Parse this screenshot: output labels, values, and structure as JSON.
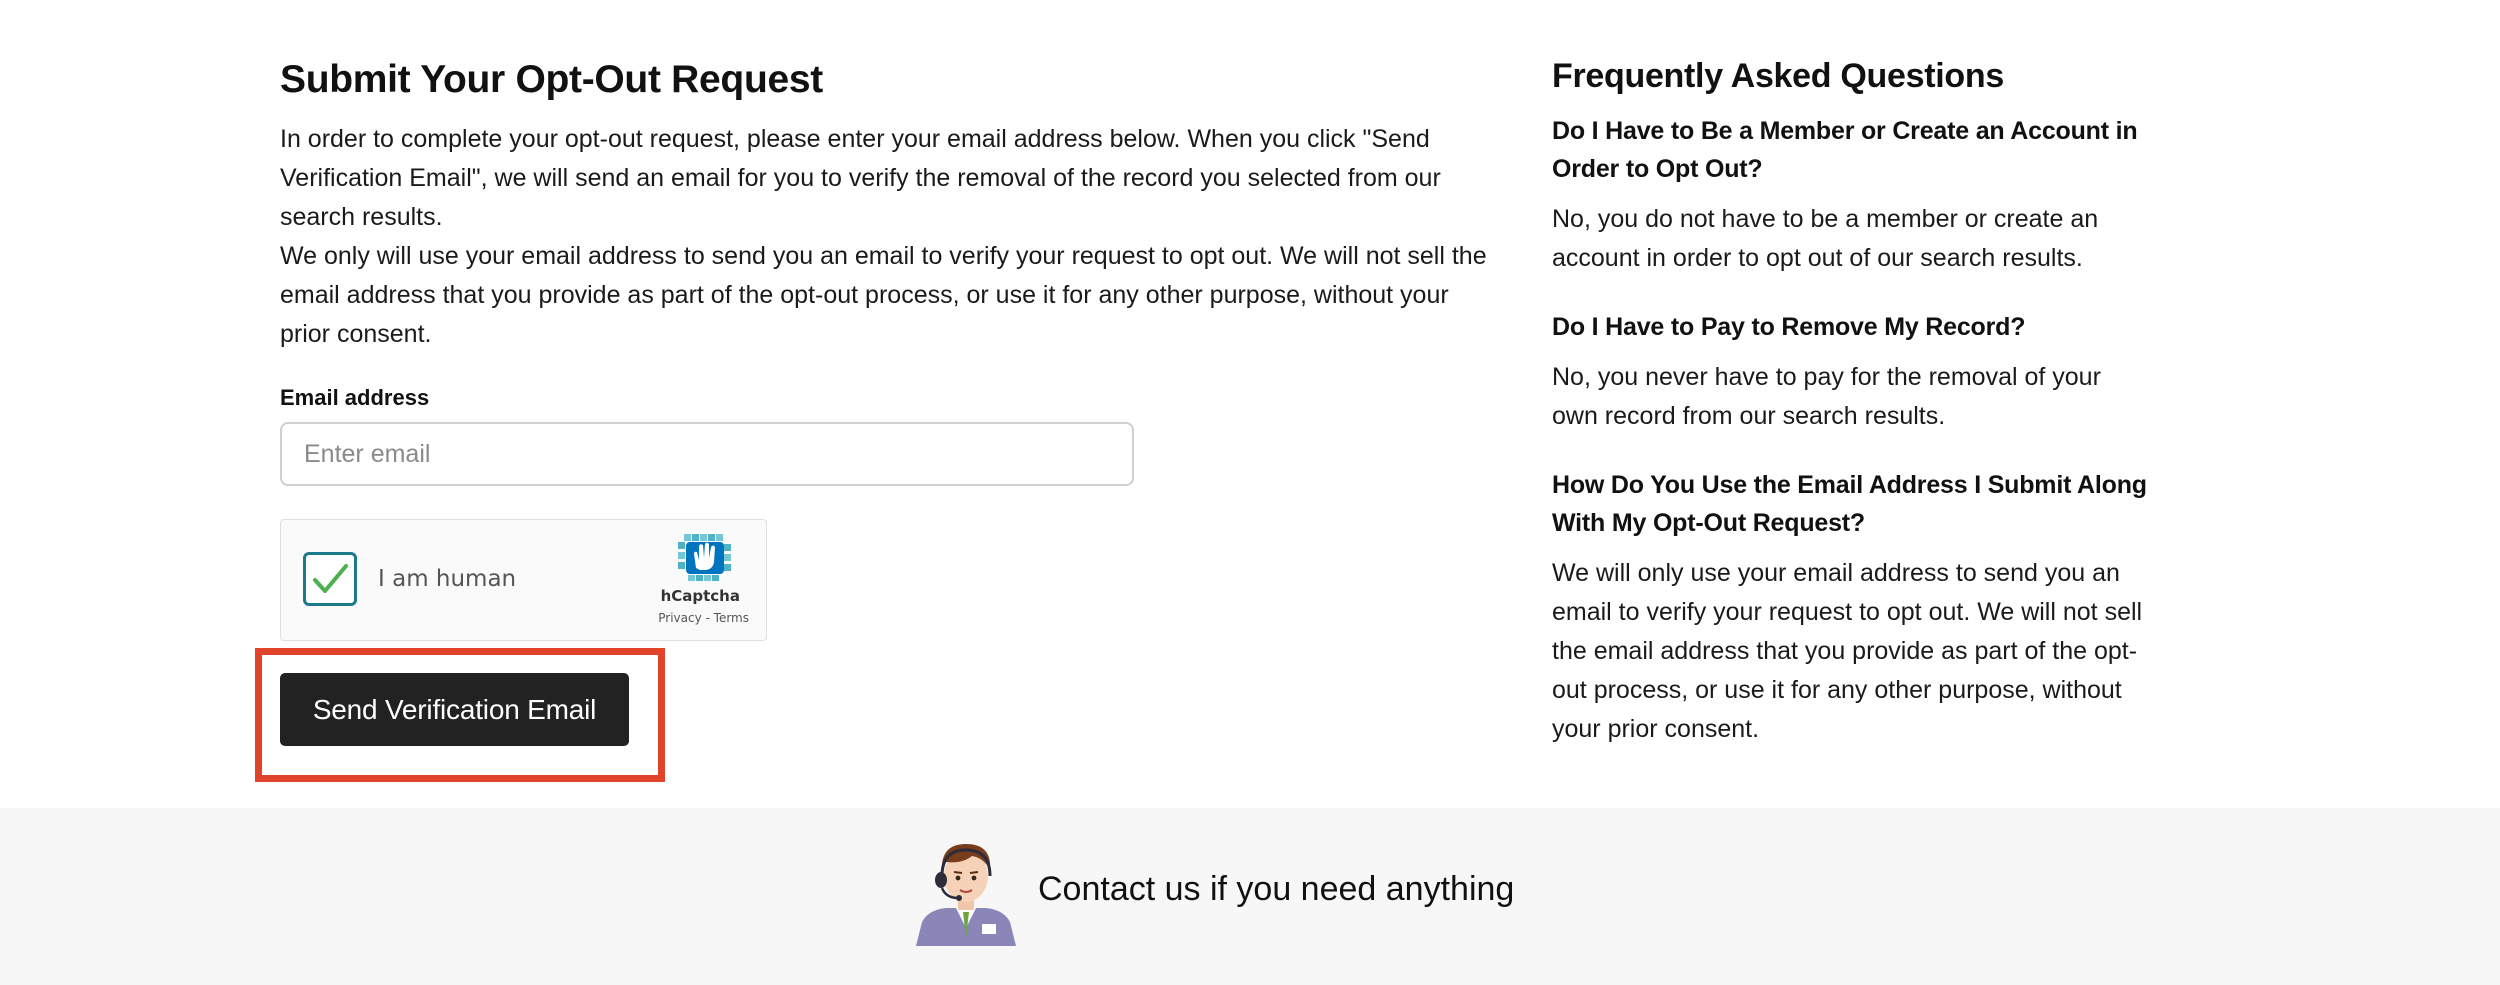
{
  "form": {
    "title": "Submit Your Opt-Out Request",
    "intro_paragraphs": [
      "In order to complete your opt-out request, please enter your email address below. When you click \"Send Verification Email\", we will send an email for you to verify the removal of the record you selected from our search results.",
      "We only will use your email address to send you an email to verify your request to opt out. We will not sell the email address that you provide as part of the opt-out process, or use it for any other purpose, without your prior consent."
    ],
    "email_label": "Email address",
    "email_placeholder": "Enter email",
    "email_value": "",
    "captcha": {
      "label": "I am human",
      "checked": true,
      "brand": "hCaptcha",
      "links": "Privacy - Terms",
      "logo_icon": "hcaptcha-hand-icon"
    },
    "submit_label": "Send Verification Email",
    "highlight_color": "#e1432b"
  },
  "faq": {
    "title": "Frequently Asked Questions",
    "items": [
      {
        "question": "Do I Have to Be a Member or Create an Account in Order to Opt Out?",
        "answer": "No, you do not have to be a member or create an account in order to opt out of our search results."
      },
      {
        "question": "Do I Have to Pay to Remove My Record?",
        "answer": "No, you never have to pay for the removal of your own record from our search results."
      },
      {
        "question": "How Do You Use the Email Address I Submit Along With My Opt-Out Request?",
        "answer": "We will only use your email address to send you an email to verify your request to opt out. We will not sell the email address that you provide as part of the opt-out process, or use it for any other purpose, without your prior consent."
      }
    ]
  },
  "footer": {
    "contact_text": "Contact us if you need anything",
    "icon": "support-agent-icon"
  }
}
